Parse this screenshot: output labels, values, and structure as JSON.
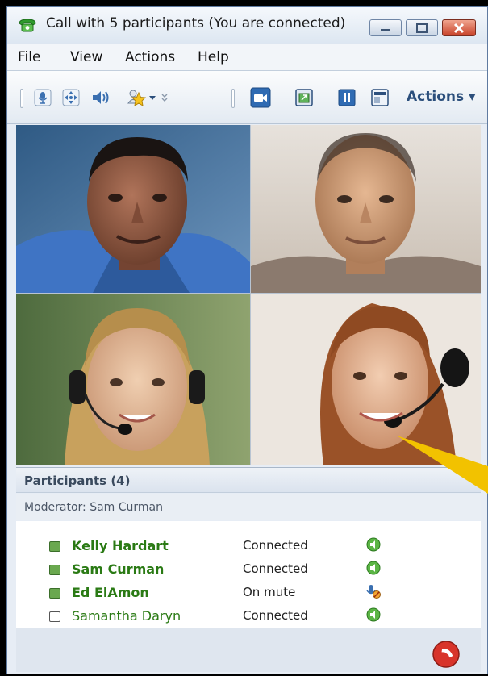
{
  "window": {
    "title": "Call with 5 participants (You are connected)"
  },
  "menu": [
    "File",
    "View",
    "Actions",
    "Help"
  ],
  "toolbar": {
    "actions_label": "Actions ▾",
    "icons": [
      "mic-icon",
      "video-pan-icon",
      "speaker-icon",
      "effects-star-icon",
      "camera-icon",
      "picture-in-picture-icon",
      "pause-icon",
      "layout-icon"
    ]
  },
  "participants": {
    "header": "Participants (4)",
    "moderator": "Moderator: Sam Curman",
    "rows": [
      {
        "name": "Kelly Hardart",
        "status": "Connected",
        "icon": "speaker-active-icon"
      },
      {
        "name": "Sam Curman",
        "status": "Connected",
        "icon": "speaker-active-icon"
      },
      {
        "name": "Ed ElAmon",
        "status": "On mute",
        "icon": "mic-muted-icon"
      },
      {
        "name": "Samantha Daryn",
        "status": "Connected",
        "icon": "speaker-active-icon"
      }
    ]
  },
  "colors": {
    "name_green": "#2a7a14",
    "accent_blue": "#2c4f7c",
    "hangup_red": "#d8342a",
    "pointer_yellow": "#f2c200"
  }
}
